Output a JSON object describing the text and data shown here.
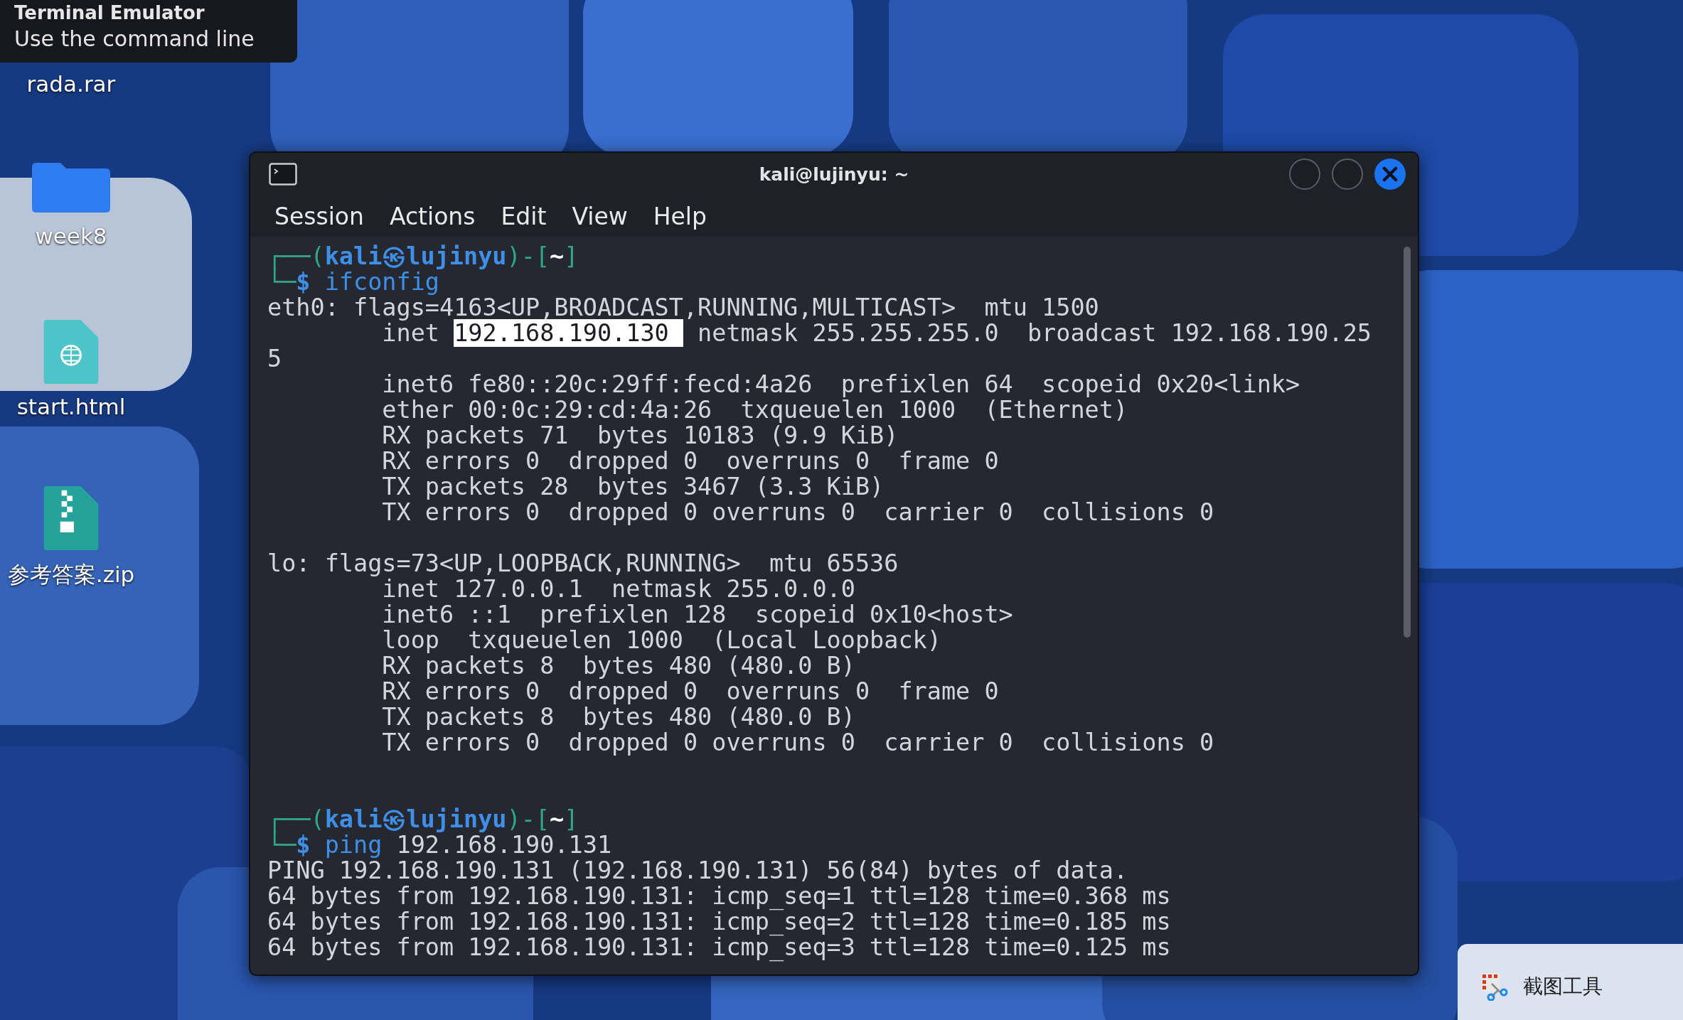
{
  "tooltip": {
    "title": "Terminal Emulator",
    "description": "Use the command line"
  },
  "desktop_icons": [
    {
      "kind": "archive-hidden",
      "label": "rada.rar"
    },
    {
      "kind": "folder",
      "label": "week8"
    },
    {
      "kind": "html",
      "label": "start.html"
    },
    {
      "kind": "zip",
      "label": "参考答案.zip"
    }
  ],
  "terminal": {
    "title": "kali@lujinyu: ~",
    "menu": [
      "Session",
      "Actions",
      "Edit",
      "View",
      "Help"
    ],
    "lines": [
      {
        "kind": "text",
        "segments": [
          {
            "kind": "frame",
            "text": "┌──("
          },
          {
            "kind": "user",
            "text": "kali㉿lujinyu"
          },
          {
            "kind": "frame",
            "text": ")-["
          },
          {
            "kind": "path",
            "text": "~"
          },
          {
            "kind": "frame",
            "text": "]"
          }
        ]
      },
      {
        "kind": "text",
        "segments": [
          {
            "kind": "frame",
            "text": "└─"
          },
          {
            "kind": "user",
            "text": "$"
          },
          {
            "kind": "command",
            "text": " ifconfig"
          }
        ]
      },
      {
        "kind": "text",
        "segments": [
          {
            "kind": "plain",
            "text": "eth0: flags=4163<UP,BROADCAST,RUNNING,MULTICAST>  mtu 1500"
          }
        ]
      },
      {
        "kind": "text",
        "segments": [
          {
            "kind": "plain",
            "text": "        inet "
          },
          {
            "kind": "selected",
            "text": "192.168.190.130 "
          },
          {
            "kind": "plain",
            "text": " netmask 255.255.255.0  broadcast 192.168.190.25"
          }
        ]
      },
      {
        "kind": "text",
        "segments": [
          {
            "kind": "plain",
            "text": "5"
          }
        ]
      },
      {
        "kind": "text",
        "segments": [
          {
            "kind": "plain",
            "text": "        inet6 fe80::20c:29ff:fecd:4a26  prefixlen 64  scopeid 0x20<link>"
          }
        ]
      },
      {
        "kind": "text",
        "segments": [
          {
            "kind": "plain",
            "text": "        ether 00:0c:29:cd:4a:26  txqueuelen 1000  (Ethernet)"
          }
        ]
      },
      {
        "kind": "text",
        "segments": [
          {
            "kind": "plain",
            "text": "        RX packets 71  bytes 10183 (9.9 KiB)"
          }
        ]
      },
      {
        "kind": "text",
        "segments": [
          {
            "kind": "plain",
            "text": "        RX errors 0  dropped 0  overruns 0  frame 0"
          }
        ]
      },
      {
        "kind": "text",
        "segments": [
          {
            "kind": "plain",
            "text": "        TX packets 28  bytes 3467 (3.3 KiB)"
          }
        ]
      },
      {
        "kind": "text",
        "segments": [
          {
            "kind": "plain",
            "text": "        TX errors 0  dropped 0 overruns 0  carrier 0  collisions 0"
          }
        ]
      },
      {
        "kind": "blank"
      },
      {
        "kind": "text",
        "segments": [
          {
            "kind": "plain",
            "text": "lo: flags=73<UP,LOOPBACK,RUNNING>  mtu 65536"
          }
        ]
      },
      {
        "kind": "text",
        "segments": [
          {
            "kind": "plain",
            "text": "        inet 127.0.0.1  netmask 255.0.0.0"
          }
        ]
      },
      {
        "kind": "text",
        "segments": [
          {
            "kind": "plain",
            "text": "        inet6 ::1  prefixlen 128  scopeid 0x10<host>"
          }
        ]
      },
      {
        "kind": "text",
        "segments": [
          {
            "kind": "plain",
            "text": "        loop  txqueuelen 1000  (Local Loopback)"
          }
        ]
      },
      {
        "kind": "text",
        "segments": [
          {
            "kind": "plain",
            "text": "        RX packets 8  bytes 480 (480.0 B)"
          }
        ]
      },
      {
        "kind": "text",
        "segments": [
          {
            "kind": "plain",
            "text": "        RX errors 0  dropped 0  overruns 0  frame 0"
          }
        ]
      },
      {
        "kind": "text",
        "segments": [
          {
            "kind": "plain",
            "text": "        TX packets 8  bytes 480 (480.0 B)"
          }
        ]
      },
      {
        "kind": "text",
        "segments": [
          {
            "kind": "plain",
            "text": "        TX errors 0  dropped 0 overruns 0  carrier 0  collisions 0"
          }
        ]
      },
      {
        "kind": "blank"
      },
      {
        "kind": "blank"
      },
      {
        "kind": "text",
        "segments": [
          {
            "kind": "frame",
            "text": "┌──("
          },
          {
            "kind": "user",
            "text": "kali㉿lujinyu"
          },
          {
            "kind": "frame",
            "text": ")-["
          },
          {
            "kind": "path",
            "text": "~"
          },
          {
            "kind": "frame",
            "text": "]"
          }
        ]
      },
      {
        "kind": "text",
        "segments": [
          {
            "kind": "frame",
            "text": "└─"
          },
          {
            "kind": "user",
            "text": "$"
          },
          {
            "kind": "command",
            "text": " ping"
          },
          {
            "kind": "plain",
            "text": " 192.168.190.131"
          }
        ]
      },
      {
        "kind": "text",
        "segments": [
          {
            "kind": "plain",
            "text": "PING 192.168.190.131 (192.168.190.131) 56(84) bytes of data."
          }
        ]
      },
      {
        "kind": "text",
        "segments": [
          {
            "kind": "plain",
            "text": "64 bytes from 192.168.190.131: icmp_seq=1 ttl=128 time=0.368 ms"
          }
        ]
      },
      {
        "kind": "text",
        "segments": [
          {
            "kind": "plain",
            "text": "64 bytes from 192.168.190.131: icmp_seq=2 ttl=128 time=0.185 ms"
          }
        ]
      },
      {
        "kind": "text",
        "segments": [
          {
            "kind": "plain",
            "text": "64 bytes from 192.168.190.131: icmp_seq=3 ttl=128 time=0.125 ms"
          }
        ]
      }
    ]
  },
  "notification": {
    "label": "截图工具"
  }
}
